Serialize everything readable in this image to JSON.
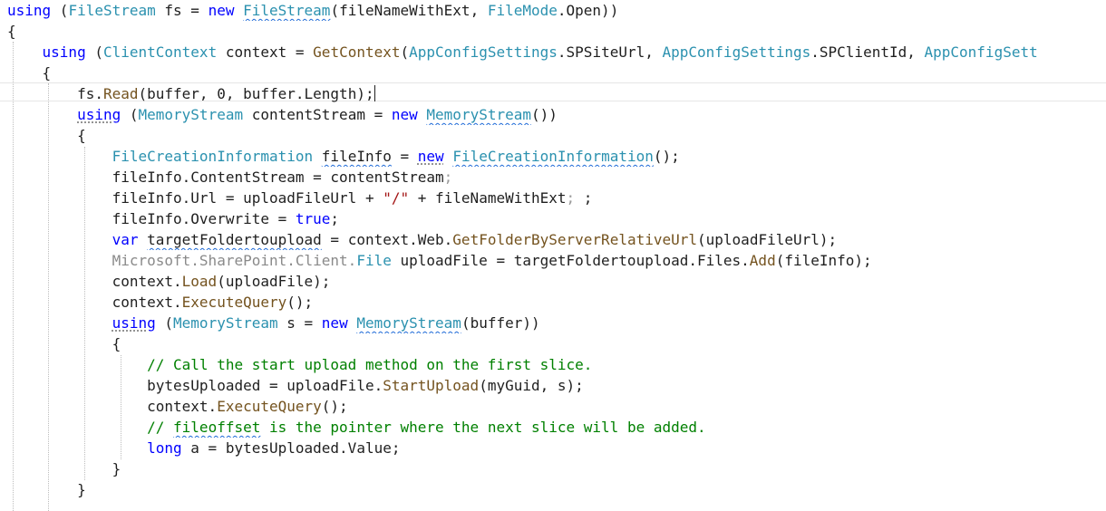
{
  "lines": [
    [
      {
        "t": "using",
        "c": "kw"
      },
      {
        "t": " (",
        "c": "pl"
      },
      {
        "t": "FileStream",
        "c": "ty"
      },
      {
        "t": " fs = ",
        "c": "pl"
      },
      {
        "t": "new",
        "c": "kw"
      },
      {
        "t": " ",
        "c": "pl"
      },
      {
        "t": "FileStream",
        "c": "ty",
        "d": "squig"
      },
      {
        "t": "(fileNameWithExt, ",
        "c": "pl"
      },
      {
        "t": "FileMode",
        "c": "ty"
      },
      {
        "t": ".Open))",
        "c": "pl"
      }
    ],
    [
      {
        "t": "{",
        "c": "pl"
      }
    ],
    [
      {
        "t": "    ",
        "c": "pl"
      },
      {
        "t": "using",
        "c": "kw"
      },
      {
        "t": " (",
        "c": "pl"
      },
      {
        "t": "ClientContext",
        "c": "ty"
      },
      {
        "t": " context = ",
        "c": "pl"
      },
      {
        "t": "GetContext",
        "c": "mt"
      },
      {
        "t": "(",
        "c": "pl"
      },
      {
        "t": "AppConfigSettings",
        "c": "ty"
      },
      {
        "t": ".SPSiteUrl, ",
        "c": "pl"
      },
      {
        "t": "AppConfigSettings",
        "c": "ty"
      },
      {
        "t": ".SPClientId, ",
        "c": "pl"
      },
      {
        "t": "AppConfigSett",
        "c": "ty"
      }
    ],
    [
      {
        "t": "    {",
        "c": "pl"
      }
    ],
    [
      {
        "t": "        fs.",
        "c": "pl"
      },
      {
        "t": "Read",
        "c": "mt"
      },
      {
        "t": "(buffer, 0, buffer.Length);",
        "c": "pl"
      },
      {
        "t": "",
        "c": "pl",
        "caret": true
      }
    ],
    [
      {
        "t": "        ",
        "c": "pl"
      },
      {
        "t": "using",
        "c": "kw",
        "d": "dots"
      },
      {
        "t": " (",
        "c": "pl"
      },
      {
        "t": "MemoryStream",
        "c": "ty"
      },
      {
        "t": " contentStream = ",
        "c": "pl"
      },
      {
        "t": "new",
        "c": "kw"
      },
      {
        "t": " ",
        "c": "pl"
      },
      {
        "t": "MemoryStream",
        "c": "ty",
        "d": "squig"
      },
      {
        "t": "())",
        "c": "pl"
      }
    ],
    [
      {
        "t": "        {",
        "c": "pl"
      }
    ],
    [
      {
        "t": "            ",
        "c": "pl"
      },
      {
        "t": "FileCreationInformation",
        "c": "ty"
      },
      {
        "t": " ",
        "c": "pl"
      },
      {
        "t": "fileInfo",
        "c": "pl",
        "d": "squig"
      },
      {
        "t": " = ",
        "c": "pl"
      },
      {
        "t": "new",
        "c": "kw",
        "d": "dots"
      },
      {
        "t": " ",
        "c": "pl"
      },
      {
        "t": "FileCreationInformation",
        "c": "ty",
        "d": "squig"
      },
      {
        "t": "();",
        "c": "pl"
      }
    ],
    [
      {
        "t": "            fileInfo.ContentStream = contentStream",
        "c": "pl"
      },
      {
        "t": ";",
        "c": "faint"
      }
    ],
    [
      {
        "t": "            fileInfo.Url = uploadFileUrl + ",
        "c": "pl"
      },
      {
        "t": "\"/\"",
        "c": "st"
      },
      {
        "t": " + fileNameWithExt",
        "c": "pl"
      },
      {
        "t": ";",
        "c": "faint"
      },
      {
        "t": " ;",
        "c": "pl"
      }
    ],
    [
      {
        "t": "            fileInfo.Overwrite = ",
        "c": "pl"
      },
      {
        "t": "true",
        "c": "kw"
      },
      {
        "t": ";",
        "c": "pl"
      }
    ],
    [
      {
        "t": "            ",
        "c": "pl"
      },
      {
        "t": "var",
        "c": "kw"
      },
      {
        "t": " ",
        "c": "pl"
      },
      {
        "t": "targetFoldertoupload",
        "c": "pl",
        "d": "squig"
      },
      {
        "t": " = context.Web.",
        "c": "pl"
      },
      {
        "t": "GetFolderByServerRelativeUrl",
        "c": "mt"
      },
      {
        "t": "(uploadFileUrl);",
        "c": "pl"
      }
    ],
    [
      {
        "t": "            ",
        "c": "pl"
      },
      {
        "t": "Microsoft.SharePoint.Client.",
        "c": "gr"
      },
      {
        "t": "File",
        "c": "ty"
      },
      {
        "t": " uploadFile = targetFoldertoupload.Files.",
        "c": "pl"
      },
      {
        "t": "Add",
        "c": "mt"
      },
      {
        "t": "(fileInfo);",
        "c": "pl"
      }
    ],
    [
      {
        "t": "            context.",
        "c": "pl"
      },
      {
        "t": "Load",
        "c": "mt"
      },
      {
        "t": "(uploadFile);",
        "c": "pl"
      }
    ],
    [
      {
        "t": "            context.",
        "c": "pl"
      },
      {
        "t": "ExecuteQuery",
        "c": "mt"
      },
      {
        "t": "();",
        "c": "pl"
      }
    ],
    [
      {
        "t": "            ",
        "c": "pl"
      },
      {
        "t": "using",
        "c": "kw",
        "d": "dots"
      },
      {
        "t": " (",
        "c": "pl"
      },
      {
        "t": "MemoryStream",
        "c": "ty"
      },
      {
        "t": " s = ",
        "c": "pl"
      },
      {
        "t": "new",
        "c": "kw"
      },
      {
        "t": " ",
        "c": "pl"
      },
      {
        "t": "MemoryStream",
        "c": "ty",
        "d": "squig"
      },
      {
        "t": "(buffer))",
        "c": "pl"
      }
    ],
    [
      {
        "t": "            {",
        "c": "pl"
      }
    ],
    [
      {
        "t": "                ",
        "c": "pl"
      },
      {
        "t": "// Call the start upload method on the first slice.",
        "c": "cm"
      }
    ],
    [
      {
        "t": "                bytesUploaded = uploadFile.",
        "c": "pl"
      },
      {
        "t": "StartUpload",
        "c": "mt"
      },
      {
        "t": "(myGuid, s);",
        "c": "pl"
      }
    ],
    [
      {
        "t": "                context.",
        "c": "pl"
      },
      {
        "t": "ExecuteQuery",
        "c": "mt"
      },
      {
        "t": "();",
        "c": "pl"
      }
    ],
    [
      {
        "t": "                ",
        "c": "pl"
      },
      {
        "t": "// ",
        "c": "cm"
      },
      {
        "t": "fileoffset",
        "c": "cm",
        "d": "squig"
      },
      {
        "t": " is the pointer where the next slice will be added.",
        "c": "cm"
      }
    ],
    [
      {
        "t": "                ",
        "c": "pl"
      },
      {
        "t": "long",
        "c": "kw"
      },
      {
        "t": " a = bytesUploaded.Value;",
        "c": "pl"
      }
    ],
    [
      {
        "t": "            }",
        "c": "pl"
      }
    ],
    [
      {
        "t": "        }",
        "c": "pl"
      }
    ],
    [
      {
        "t": "",
        "c": "pl"
      }
    ]
  ]
}
